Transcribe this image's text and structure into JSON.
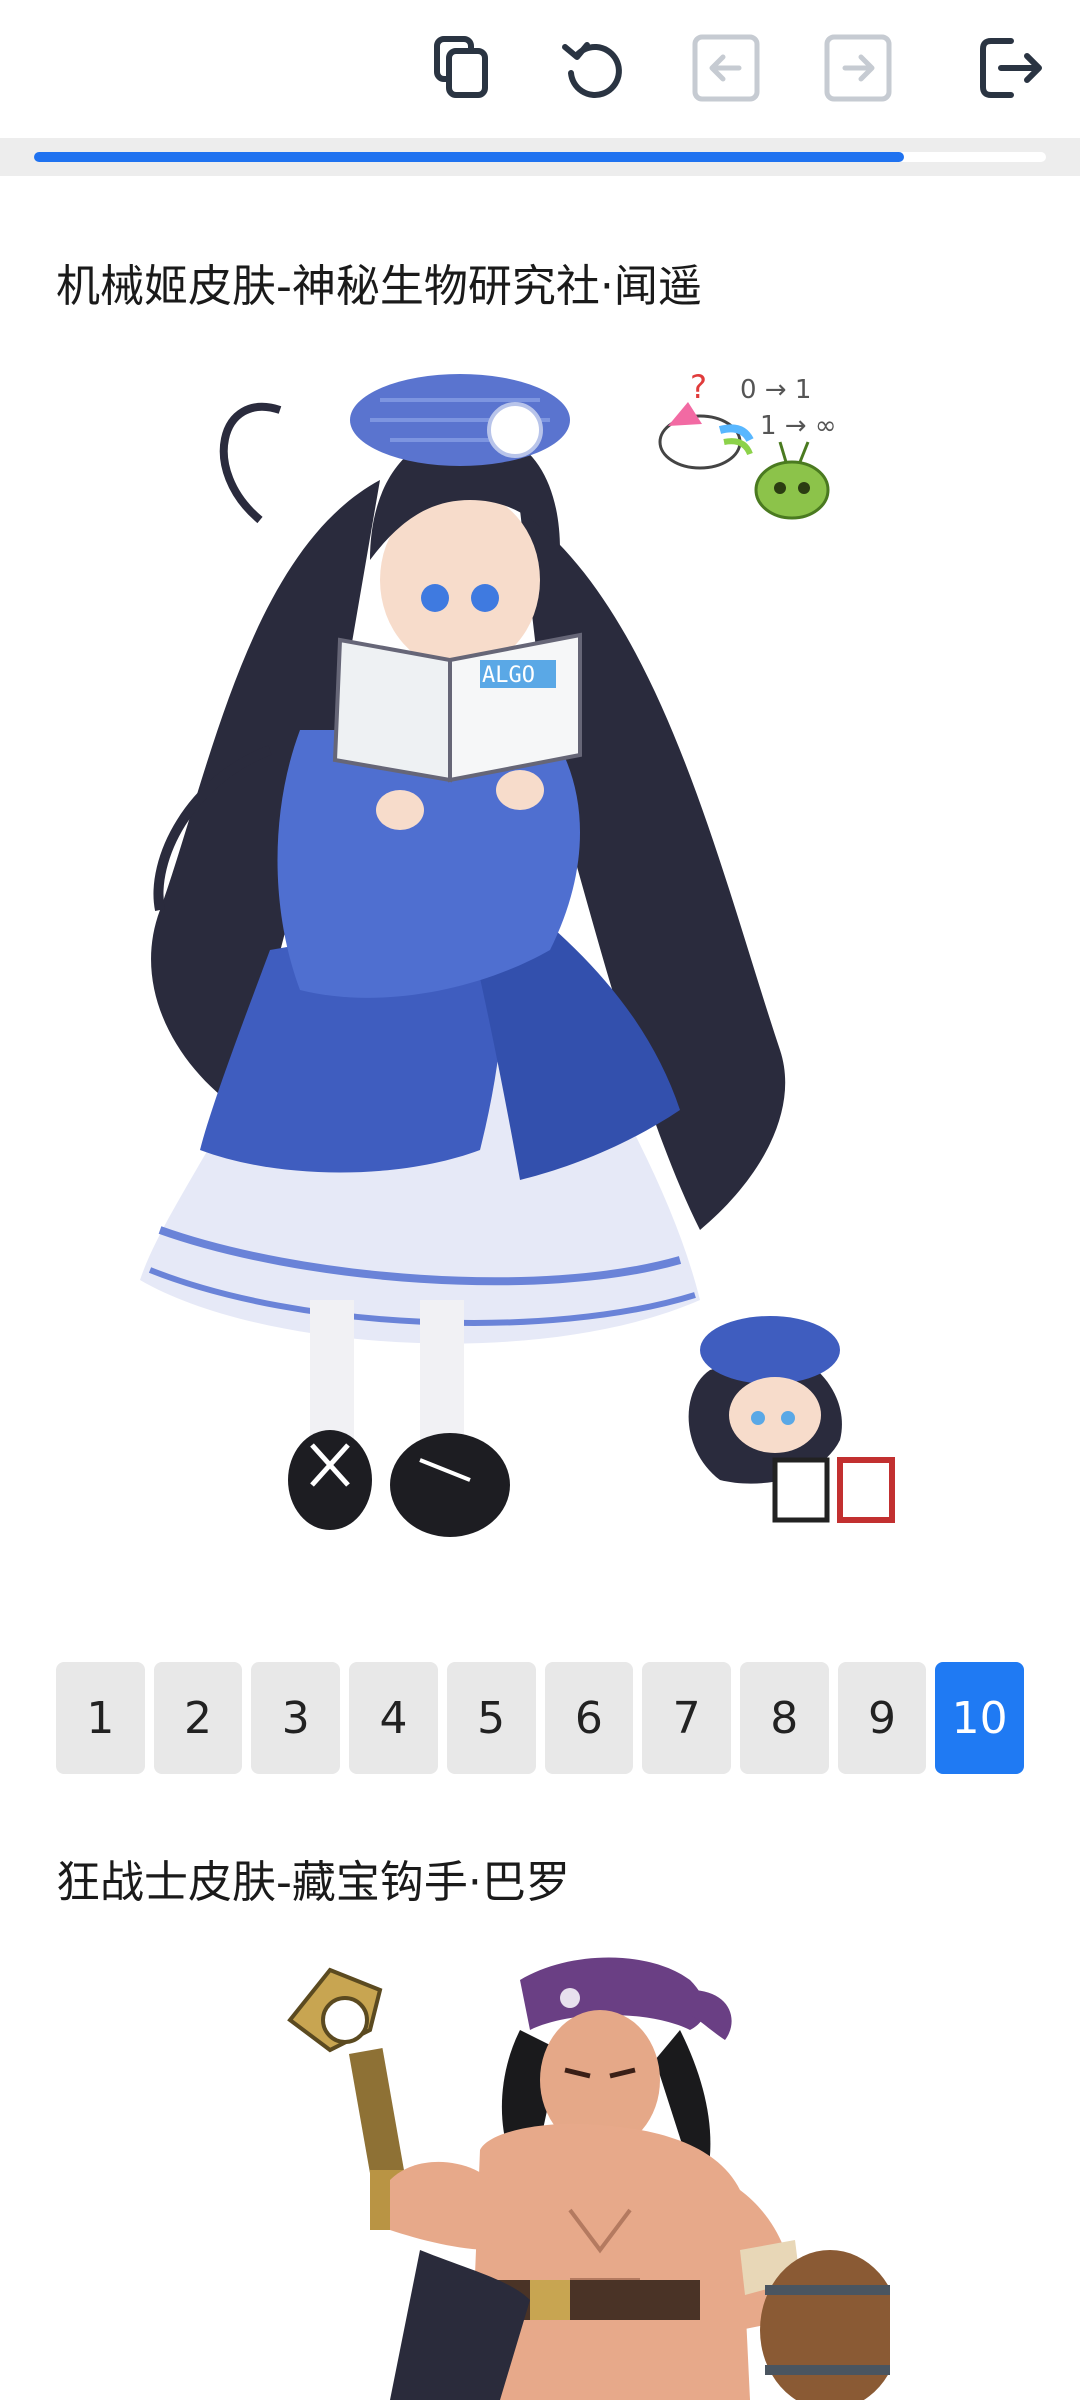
{
  "toolbar": {
    "buttons": [
      {
        "name": "copy",
        "icon": "copy-icon",
        "enabled": true
      },
      {
        "name": "refresh",
        "icon": "refresh-icon",
        "enabled": true
      },
      {
        "name": "back",
        "icon": "arrow-left-icon",
        "enabled": false
      },
      {
        "name": "forward",
        "icon": "arrow-right-icon",
        "enabled": false
      },
      {
        "name": "exit",
        "icon": "logout-icon",
        "enabled": true
      }
    ]
  },
  "progress": {
    "value": 0.86,
    "color": "#1f72f0"
  },
  "sections": [
    {
      "title": "机械姬皮肤-神秘生物研究社·闻遥"
    },
    {
      "title": "狂战士皮肤-藏宝钩手·巴罗"
    }
  ],
  "pagination": {
    "pages": [
      "1",
      "2",
      "3",
      "4",
      "5",
      "6",
      "7",
      "8",
      "9",
      "10"
    ],
    "current": "10",
    "active_color": "#1f7af3"
  },
  "images": {
    "art1_doodle_text": [
      "0 → 1",
      "1 → ∞"
    ],
    "art1_book_text": "ALGO"
  }
}
